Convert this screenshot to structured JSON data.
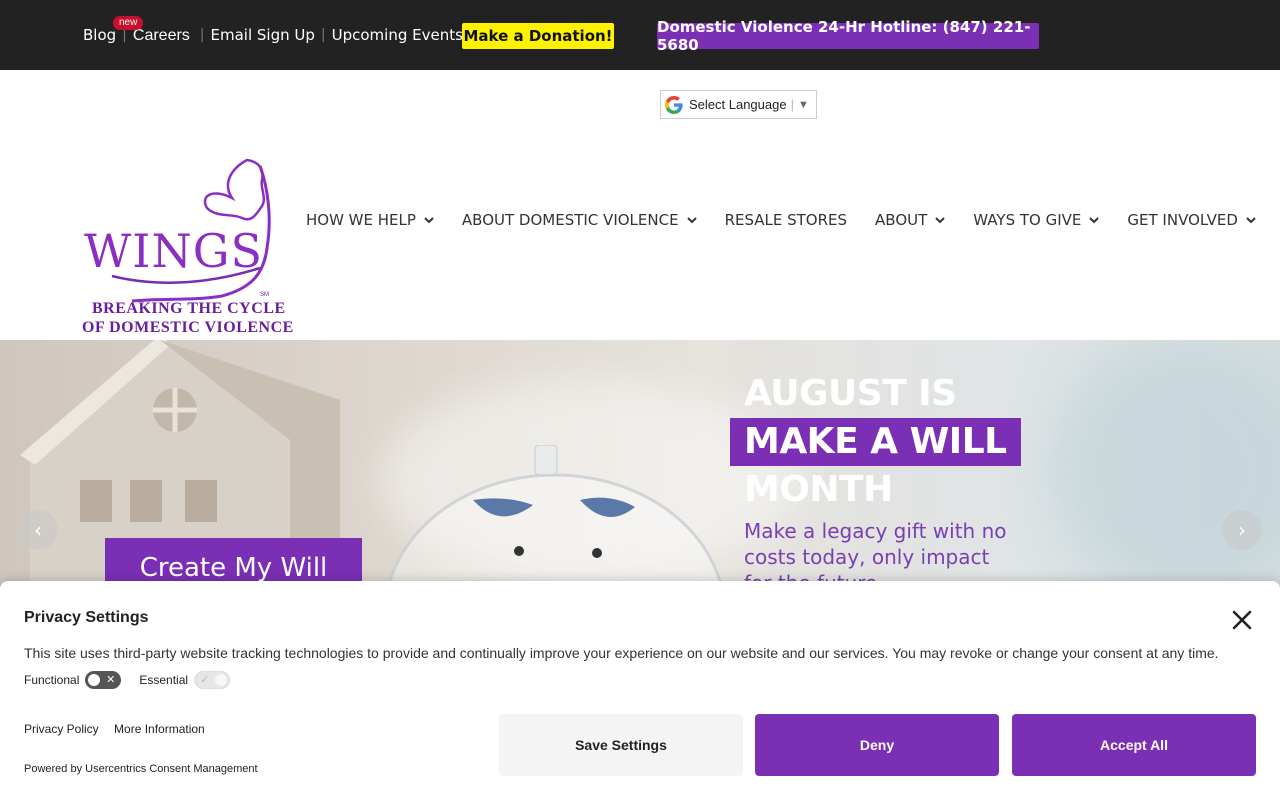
{
  "topbar": {
    "blog": "Blog",
    "new_badge": "new",
    "careers": "Careers",
    "email_signup": "Email Sign Up",
    "upcoming_events": "Upcoming Events",
    "donate": "Make a Donation!",
    "hotline": "Domestic Violence 24-Hr Hotline: (847) 221-5680",
    "colors": {
      "bar": "#222222",
      "donate": "#fff200",
      "hotline": "#7b2fb5"
    }
  },
  "language": {
    "label": "Select Language",
    "arrow": "▼",
    "icon": "google-g-icon"
  },
  "logo": {
    "wordmark": "WINGS",
    "tagline_line1": "BREAKING THE CYCLE",
    "tagline_line2": "OF DOMESTIC VIOLENCE",
    "sm": "SM"
  },
  "nav": {
    "items": [
      {
        "label": "HOW WE HELP",
        "has_dropdown": true
      },
      {
        "label": "ABOUT DOMESTIC VIOLENCE",
        "has_dropdown": true
      },
      {
        "label": "RESALE STORES",
        "has_dropdown": false
      },
      {
        "label": "ABOUT",
        "has_dropdown": true
      },
      {
        "label": "WAYS TO GIVE",
        "has_dropdown": true
      },
      {
        "label": "GET INVOLVED",
        "has_dropdown": true
      }
    ]
  },
  "hero": {
    "line1": "AUGUST IS",
    "line2": "MAKE A WILL",
    "line3": "MONTH",
    "sub_line1": "Make a legacy gift with no",
    "sub_line2": "costs today, only impact",
    "sub_line3": "for the future.",
    "cta": "Create My Will",
    "prev": "‹",
    "next": "›"
  },
  "consent": {
    "title": "Privacy Settings",
    "description": "This site uses third-party website tracking technologies to provide and continually improve your experience on our website and our services. You may revoke or change your consent at any time.",
    "functional": "Functional",
    "essential": "Essential",
    "privacy_policy": "Privacy Policy",
    "more_info": "More Information",
    "powered_by": "Powered by Usercentrics Consent Management",
    "save": "Save Settings",
    "deny": "Deny",
    "accept": "Accept All",
    "accent": "#7b2fb5"
  }
}
